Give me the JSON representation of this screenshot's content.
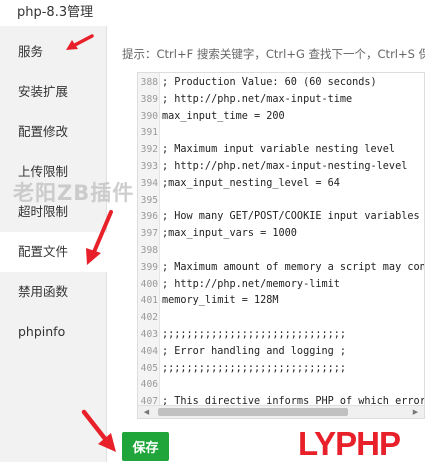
{
  "window": {
    "title": "php-8.3管理"
  },
  "sidebar": {
    "items": [
      {
        "label": "服务"
      },
      {
        "label": "安装扩展"
      },
      {
        "label": "配置修改"
      },
      {
        "label": "上传限制"
      },
      {
        "label": "超时限制"
      },
      {
        "label": "配置文件",
        "active": true
      },
      {
        "label": "禁用函数"
      },
      {
        "label": "phpinfo"
      }
    ]
  },
  "editor": {
    "tip": "提示：Ctrl+F 搜索关键字，Ctrl+G 查找下一个，Ctrl+S 保存",
    "lines": [
      {
        "num": "388",
        "text": "; Production Value: 60 (60 seconds)"
      },
      {
        "num": "389",
        "text": "; http://php.net/max-input-time"
      },
      {
        "num": "390",
        "text": "max_input_time = 200"
      },
      {
        "num": "391",
        "text": ""
      },
      {
        "num": "392",
        "text": "; Maximum input variable nesting level"
      },
      {
        "num": "393",
        "text": "; http://php.net/max-input-nesting-level"
      },
      {
        "num": "394",
        "text": ";max_input_nesting_level = 64"
      },
      {
        "num": "395",
        "text": ""
      },
      {
        "num": "396",
        "text": "; How many GET/POST/COOKIE input variables may be accepted"
      },
      {
        "num": "397",
        "text": ";max_input_vars = 1000"
      },
      {
        "num": "398",
        "text": ""
      },
      {
        "num": "399",
        "text": "; Maximum amount of memory a script may consume"
      },
      {
        "num": "400",
        "text": "; http://php.net/memory-limit"
      },
      {
        "num": "401",
        "text": "memory_limit = 128M"
      },
      {
        "num": "402",
        "text": ""
      },
      {
        "num": "403",
        "text": ";;;;;;;;;;;;;;;;;;;;;;;;;;;;;;"
      },
      {
        "num": "404",
        "text": "; Error handling and logging ;"
      },
      {
        "num": "405",
        "text": ";;;;;;;;;;;;;;;;;;;;;;;;;;;;;;"
      },
      {
        "num": "406",
        "text": ""
      },
      {
        "num": "407",
        "text": "; This directive informs PHP of which errors, warnings and notices"
      }
    ]
  },
  "actions": {
    "save_label": "保存"
  },
  "watermark": {
    "text": "老阳ZB插件"
  },
  "logo": {
    "part1": "LY",
    "part2": "PHP"
  },
  "colors": {
    "save_button": "#20a53a",
    "arrow": "#e8202a",
    "logo": "#e8202a"
  }
}
